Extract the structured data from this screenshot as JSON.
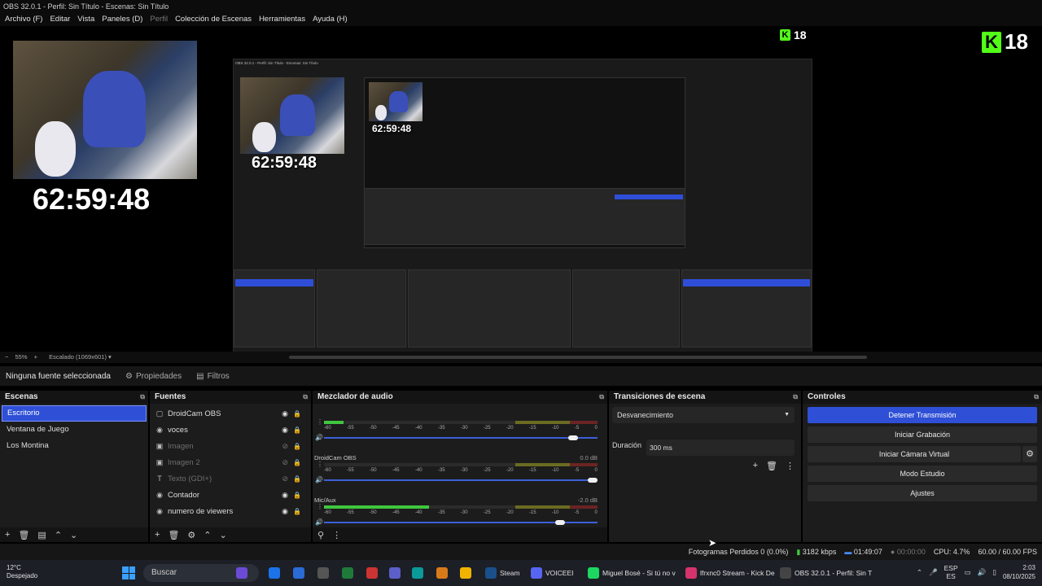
{
  "window": {
    "title": "OBS 32.0.1 - Perfil: Sin Título - Escenas: Sin Título"
  },
  "menu": [
    {
      "label": "Archivo (F)",
      "dim": false
    },
    {
      "label": "Editar",
      "dim": false
    },
    {
      "label": "Vista",
      "dim": false
    },
    {
      "label": "Paneles (D)",
      "dim": false
    },
    {
      "label": "Perfil",
      "dim": true
    },
    {
      "label": "Colección de Escenas",
      "dim": false
    },
    {
      "label": "Herramientas",
      "dim": false
    },
    {
      "label": "Ayuda (H)",
      "dim": false
    }
  ],
  "preview": {
    "clock_main": "62:59:48",
    "clock_second": "62:59:48",
    "clock_third": "62:59:48",
    "viewer_count": "18",
    "viewer_count_small": "18",
    "kick_letter": "K"
  },
  "zoom": {
    "percent": "55%",
    "minus": "−",
    "plus": "+",
    "scale_label": "Escalado (1069x601)"
  },
  "info_bar": {
    "no_source": "Ninguna fuente seleccionada",
    "properties": "Propiedades",
    "filters": "Filtros"
  },
  "scenes": {
    "title": "Escenas",
    "items": [
      {
        "label": "Escritorio",
        "selected": true
      },
      {
        "label": "Ventana de Juego",
        "selected": false
      },
      {
        "label": "Los Montina",
        "selected": false
      }
    ]
  },
  "sources": {
    "title": "Fuentes",
    "items": [
      {
        "label": "DroidCam OBS",
        "icon": "camera-icon",
        "glyph": "▢",
        "visible": true
      },
      {
        "label": "voces",
        "icon": "microphone-icon",
        "glyph": "◉",
        "visible": true
      },
      {
        "label": "Imagen",
        "icon": "image-icon",
        "glyph": "▣",
        "visible": false
      },
      {
        "label": "Imagen 2",
        "icon": "image-icon",
        "glyph": "▣",
        "visible": false
      },
      {
        "label": "Texto (GDI+)",
        "icon": "text-icon",
        "glyph": "T",
        "visible": false
      },
      {
        "label": "Contador",
        "icon": "microphone-icon",
        "glyph": "◉",
        "visible": true
      },
      {
        "label": "numero de viewers",
        "icon": "microphone-icon",
        "glyph": "◉",
        "visible": true
      }
    ]
  },
  "mixer": {
    "title": "Mezclador de audio",
    "ticks": [
      "-60",
      "-55",
      "-50",
      "-45",
      "-40",
      "-35",
      "-30",
      "-25",
      "-20",
      "-15",
      "-10",
      "-5",
      "0"
    ],
    "channels": [
      {
        "name": "",
        "db": "",
        "level": 0.1,
        "volume": 0.93
      },
      {
        "name": "DroidCam OBS",
        "db": "0.0 dB",
        "level": 0.0,
        "volume": 1.0
      },
      {
        "name": "Mic/Aux",
        "db": "-2.0 dB",
        "level": 0.55,
        "volume": 0.88
      }
    ]
  },
  "transitions": {
    "title": "Transiciones de escena",
    "selected": "Desvanecimiento",
    "duration_label": "Duración",
    "duration_value": "300 ms"
  },
  "controls": {
    "title": "Controles",
    "stop_stream": "Detener Transmisión",
    "start_recording": "Iniciar Grabación",
    "start_virtual_cam": "Iniciar Cámara Virtual",
    "studio_mode": "Modo Estudio",
    "settings": "Ajustes"
  },
  "stats": {
    "dropped_frames": "Fotogramas Perdidos 0 (0.0%)",
    "bitrate": "3182 kbps",
    "stream_time": "01:49:07",
    "record_time": "00:00:00",
    "cpu": "CPU: 4.7%",
    "fps": "60.00 / 60.00 FPS"
  },
  "taskbar": {
    "weather_temp": "12°C",
    "weather_desc": "Despejado",
    "search": "Buscar",
    "apps": [
      {
        "label": "Steam",
        "color": "#1b4f8a"
      },
      {
        "label": "VOICEEI",
        "color": "#5865f2"
      },
      {
        "label": "Miguel Bosé - Si tú no v",
        "color": "#1ed760"
      },
      {
        "label": "lfrxnc0 Stream - Kick De",
        "color": "#d6336c"
      },
      {
        "label": "OBS 32.0.1 - Perfil: Sin T",
        "color": "#444444"
      }
    ],
    "lang_top": "ESP",
    "lang_bottom": "ES",
    "time": "2:03",
    "date": "08/10/2025"
  }
}
